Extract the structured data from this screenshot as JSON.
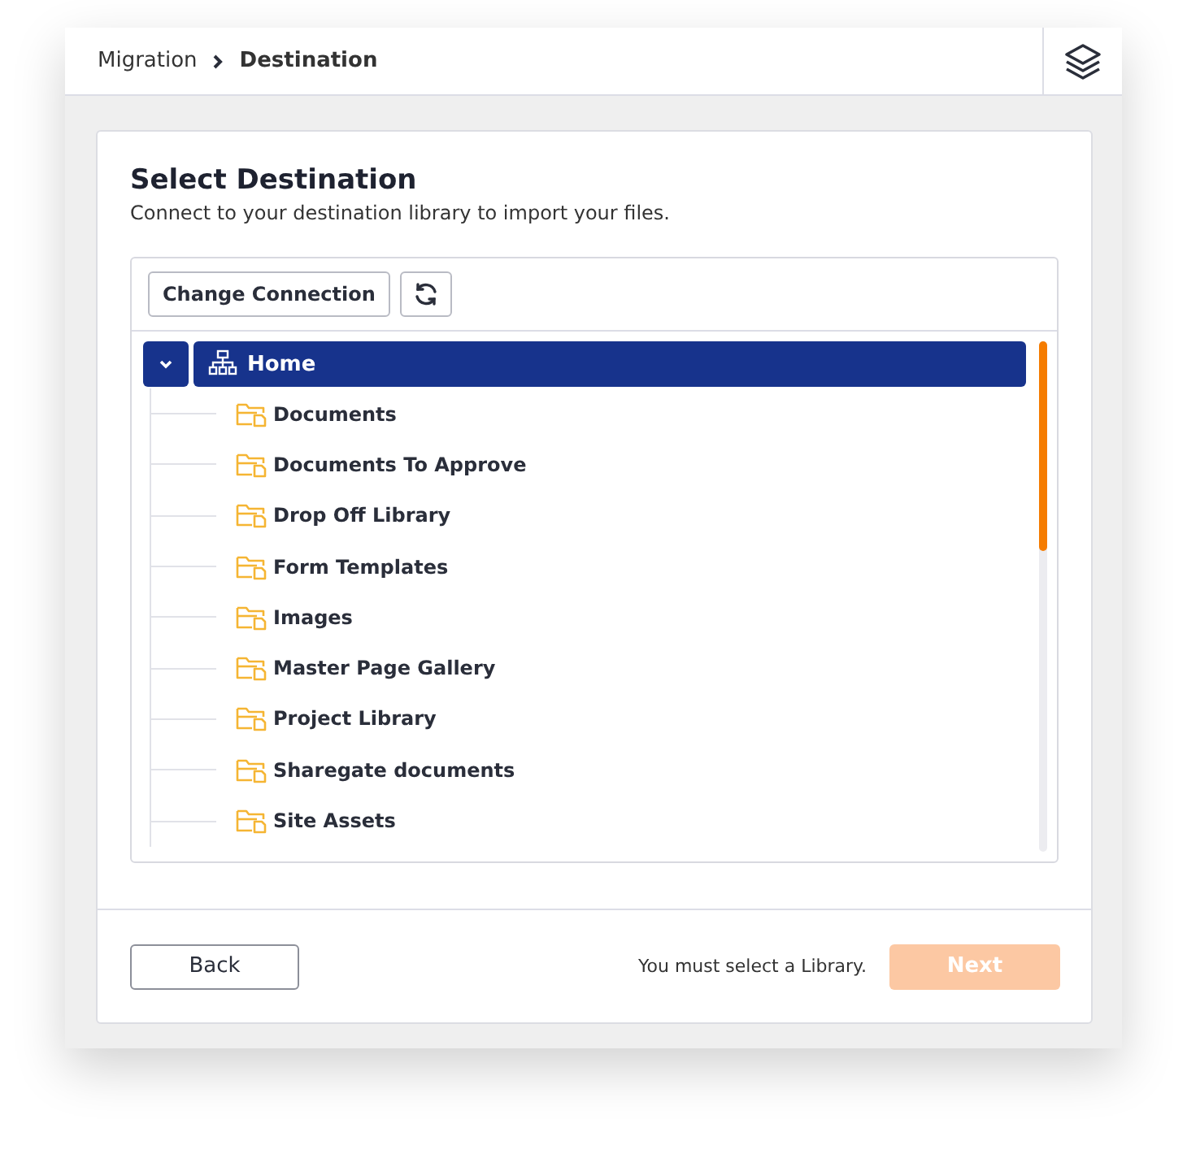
{
  "breadcrumb": [
    {
      "label": "Migration",
      "current": false
    },
    {
      "label": "Destination",
      "current": true
    }
  ],
  "heading": {
    "title": "Select Destination",
    "subtitle": "Connect to your destination library to import your files."
  },
  "toolbar": {
    "change_connection": "Change Connection"
  },
  "tree": {
    "label": "Home",
    "expanded": true,
    "selected": true,
    "children": [
      {
        "label": "Documents",
        "selected": false
      },
      {
        "label": "Documents To Approve",
        "selected": false
      },
      {
        "label": "Drop Off Library",
        "selected": false
      },
      {
        "label": "Form Templates",
        "selected": false
      },
      {
        "label": "Images",
        "selected": false
      },
      {
        "label": "Master Page Gallery",
        "selected": false
      },
      {
        "label": "Project Library",
        "selected": false
      },
      {
        "label": "Sharegate documents",
        "selected": false
      },
      {
        "label": "Site Assets",
        "selected": false
      }
    ]
  },
  "footer": {
    "back": "Back",
    "message": "You must select a Library.",
    "next": {
      "label": "Next",
      "disabled": true
    }
  }
}
